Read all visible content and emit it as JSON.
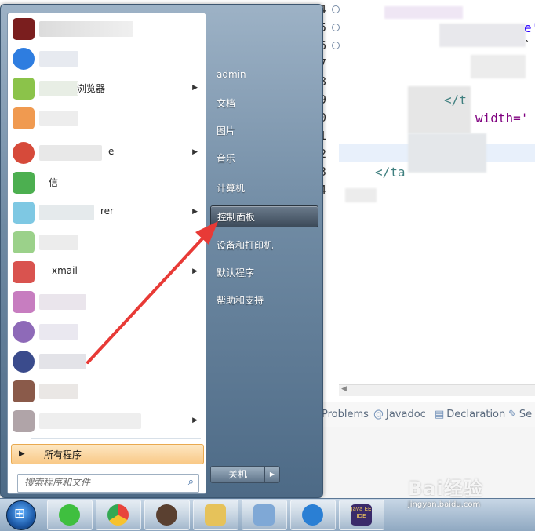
{
  "editor": {
    "line_numbers": [
      "4",
      "5",
      "6",
      "7",
      "8",
      "9",
      "0",
      "1",
      "2",
      "3",
      "4"
    ],
    "code_fragments": [
      "e'",
      "`",
      "</t",
      "width='",
      "</ta"
    ],
    "views": [
      {
        "label": "Problems",
        "icon": "problems-icon"
      },
      {
        "label": "Javadoc",
        "icon": "at-icon"
      },
      {
        "label": "Declaration",
        "icon": "declaration-icon"
      },
      {
        "label": "Se",
        "icon": "search-view-icon"
      }
    ]
  },
  "start_menu": {
    "programs": [
      {
        "name": "",
        "icon_color": "#7a1e1e",
        "has_submenu": false
      },
      {
        "name": "",
        "icon_color": "#2e7de0",
        "has_submenu": false
      },
      {
        "name": "浏览器",
        "icon_color": "#8bc34a",
        "has_submenu": true
      },
      {
        "name": "",
        "icon_color": "#f09a50",
        "has_submenu": false
      },
      {
        "name": "e",
        "icon_color": "#d64a3a",
        "has_submenu": true
      },
      {
        "name": "信",
        "icon_color": "#4caf50",
        "has_submenu": false
      },
      {
        "name": "rer",
        "icon_color": "#7ec8e3",
        "has_submenu": true
      },
      {
        "name": "",
        "icon_color": "#9bd18a",
        "has_submenu": false
      },
      {
        "name": "xmail",
        "icon_color": "#d9534f",
        "has_submenu": true
      },
      {
        "name": "",
        "icon_color": "#c77dc0",
        "has_submenu": false
      },
      {
        "name": "",
        "icon_color": "#8e6ab8",
        "has_submenu": false
      },
      {
        "name": "",
        "icon_color": "#3a4b8c",
        "has_submenu": false
      },
      {
        "name": "",
        "icon_color": "#8a5a4a",
        "has_submenu": false
      },
      {
        "name": "",
        "icon_color": "#b0a4a8",
        "has_submenu": true
      }
    ],
    "all_programs_label": "所有程序",
    "search_placeholder": "搜索程序和文件",
    "right_items": [
      {
        "label": "admin"
      },
      {
        "label": "文档"
      },
      {
        "label": "图片"
      },
      {
        "label": "音乐"
      },
      {
        "label": "计算机"
      },
      {
        "label": "控制面板",
        "selected": true
      },
      {
        "label": "设备和打印机"
      },
      {
        "label": "默认程序"
      },
      {
        "label": "帮助和支持"
      }
    ],
    "shutdown_label": "关机",
    "annotation_color": "#e83a36"
  },
  "taskbar": {
    "buttons": [
      {
        "icon": "wechat-icon",
        "color": "#3fbf3f"
      },
      {
        "icon": "chrome-icon",
        "color": "#e8453c"
      },
      {
        "icon": "photo-app-icon",
        "color": "#5a4030"
      },
      {
        "icon": "file-explorer-icon",
        "color": "#e6c25a"
      },
      {
        "icon": "notepad-icon",
        "color": "#7fa8d6"
      },
      {
        "icon": "ie-icon",
        "color": "#2a7fd4"
      },
      {
        "icon": "java-ee-ide-icon",
        "color": "#3a2a6a"
      }
    ],
    "java_ee_label": "Java EE IDE"
  },
  "watermark": {
    "brand": "Bai经验",
    "url": "jingyan.baidu.com"
  }
}
